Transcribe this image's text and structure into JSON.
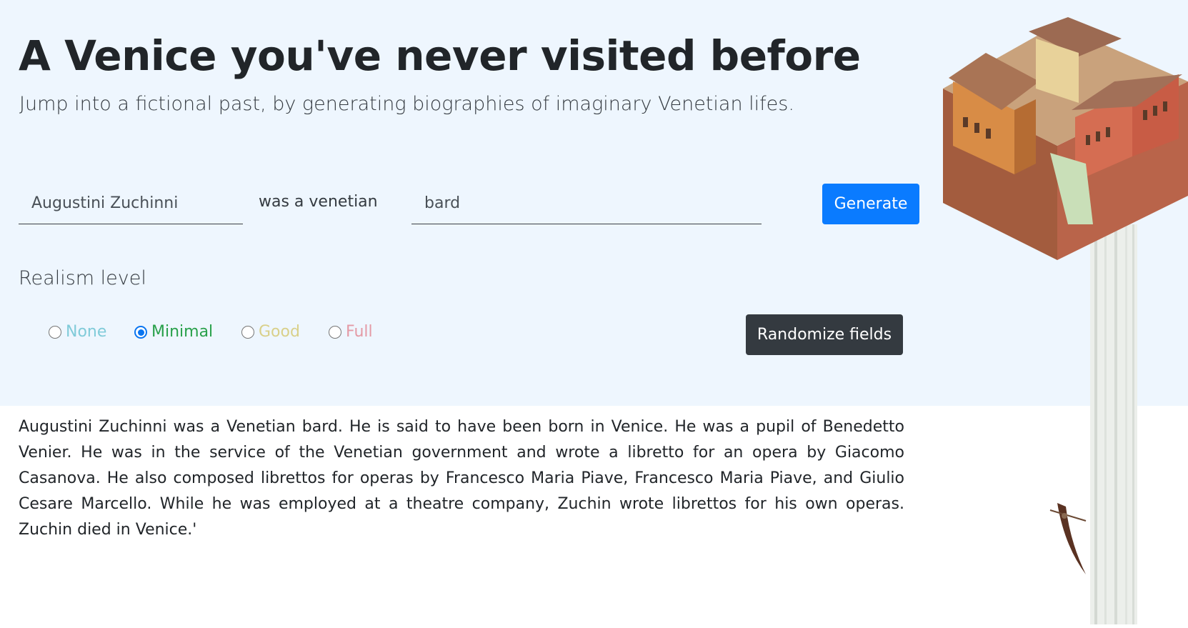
{
  "header": {
    "title": "A Venice you've never visited before",
    "subtitle": "Jump into a fictional past, by generating biographies of imaginary Venetian lifes."
  },
  "form": {
    "name_value": "Augustini Zuchinni",
    "connector": "was a venetian",
    "job_value": "bard",
    "generate_label": "Generate"
  },
  "realism": {
    "label": "Realism level",
    "options": [
      {
        "label": "None",
        "color": "#80cbd9",
        "checked": false
      },
      {
        "label": "Minimal",
        "color": "#28a04a",
        "checked": true
      },
      {
        "label": "Good",
        "color": "#d9d08a",
        "checked": false
      },
      {
        "label": "Full",
        "color": "#e49aa5",
        "checked": false
      }
    ],
    "randomize_label": "Randomize fields"
  },
  "biography": "Augustini Zuchinni was a Venetian bard. He is said to have been born in Venice. He was a pupil of Benedetto Venier. He was in the service of the Venetian government and wrote a libretto for an opera by Giacomo Casanova. He also composed librettos for operas by Francesco Maria Piave, Francesco Maria Piave, and Giulio Cesare Marcello. While he was employed at a theatre company, Zuchin wrote librettos for his own operas. Zuchin died in Venice.'",
  "colors": {
    "hero_bg": "#eef6fe",
    "primary": "#0a7bff",
    "dark": "#343a40"
  }
}
